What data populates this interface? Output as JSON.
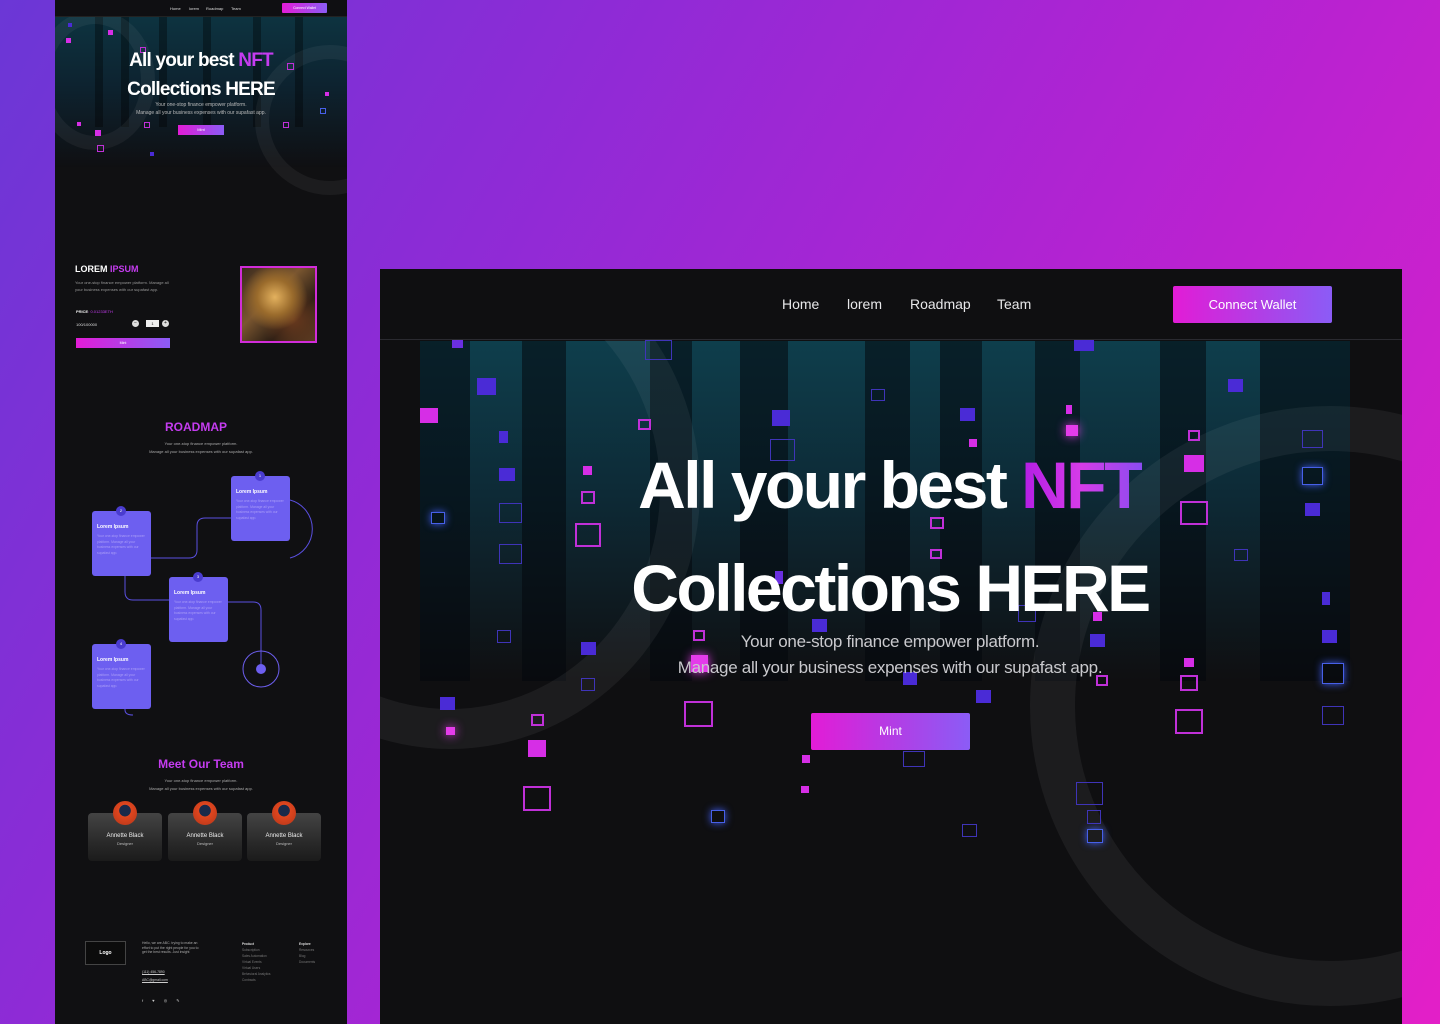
{
  "colors": {
    "accent_pink": "#e21cd6",
    "accent_violet": "#8b5cf6",
    "card_purple": "#6d5ff0",
    "page_bg": "#101012"
  },
  "mini": {
    "nav": {
      "links": [
        "Home",
        "lorem",
        "Roadmap",
        "Team"
      ],
      "connect": "Connect Wallet"
    },
    "hero": {
      "title_1": "All your best ",
      "title_nft": "NFT",
      "title_2": "Collections HERE",
      "sub_1": "Your one-stop finance empower platform.",
      "sub_2": "Manage all your business expenses with our supafast app.",
      "mint": "Mint"
    },
    "lorem": {
      "title_1": "LOREM ",
      "title_2": "IPSUM",
      "desc": "Your one-stop finance empower platform. Manage all your business expenses with our supafast app.",
      "price_label": "PRICE",
      "price_value": ": 0.01233ETH",
      "count": "100/100000",
      "minus": "−",
      "qty": "1",
      "plus": "+",
      "mint": "Mint",
      "art_icon": "nft-artwork-image"
    },
    "roadmap": {
      "title": "ROADMAP",
      "sub_1": "Your one-stop finance empower platform.",
      "sub_2": "Manage all your business expenses with our supafast app.",
      "cards": [
        {
          "num": "1",
          "title": "Lorem Ipsum",
          "desc": "Your one-stop finance empower platform. Manage all your business expenses with our supafast app."
        },
        {
          "num": "2",
          "title": "Lorem Ipsum",
          "desc": "Your one-stop finance empower platform. Manage all your business expenses with our supafast app."
        },
        {
          "num": "3",
          "title": "Lorem Ipsum",
          "desc": "Your one-stop finance empower platform. Manage all your business expenses with our supafast app."
        },
        {
          "num": "4",
          "title": "Lorem Ipsum",
          "desc": "Your one-stop finance empower platform. Manage all your business expenses with our supafast app."
        }
      ]
    },
    "team": {
      "title": "Meet Our Team",
      "sub_1": "Your one-stop finance empower platform.",
      "sub_2": "Manage all your business expenses with our supafast app.",
      "members": [
        {
          "name": "Annette Black",
          "role": "Designer"
        },
        {
          "name": "Annette Black",
          "role": "Designer"
        },
        {
          "name": "Annette Black",
          "role": "Designer"
        }
      ]
    },
    "footer": {
      "logo": "Logo",
      "text": "Hello, we are ABC. trying to make an effort to put the right people for you to get the best results. Just insight",
      "phone": "(111) 456-7890",
      "email": "ABC@gmail.com",
      "social": "f ♥ ◎ ✎",
      "col1_title": "Product",
      "col1_items": [
        "Subscription",
        "Sales Automation",
        "Virtual Events",
        "Virtual Users",
        "Behavioral Analytics",
        "Contracts"
      ],
      "col2_title": "Explore",
      "col2_items": [
        "Resources",
        "Blog",
        "Documents"
      ]
    }
  },
  "hero": {
    "nav": {
      "links": [
        "Home",
        "lorem",
        "Roadmap",
        "Team"
      ],
      "connect": "Connect Wallet"
    },
    "title_1": "All your best ",
    "title_nft": "NFT",
    "title_2": "Collections HERE",
    "sub_1": "Your one-stop finance empower platform.",
    "sub_2": "Manage all your business expenses with our supafast app.",
    "mint": "Mint"
  }
}
